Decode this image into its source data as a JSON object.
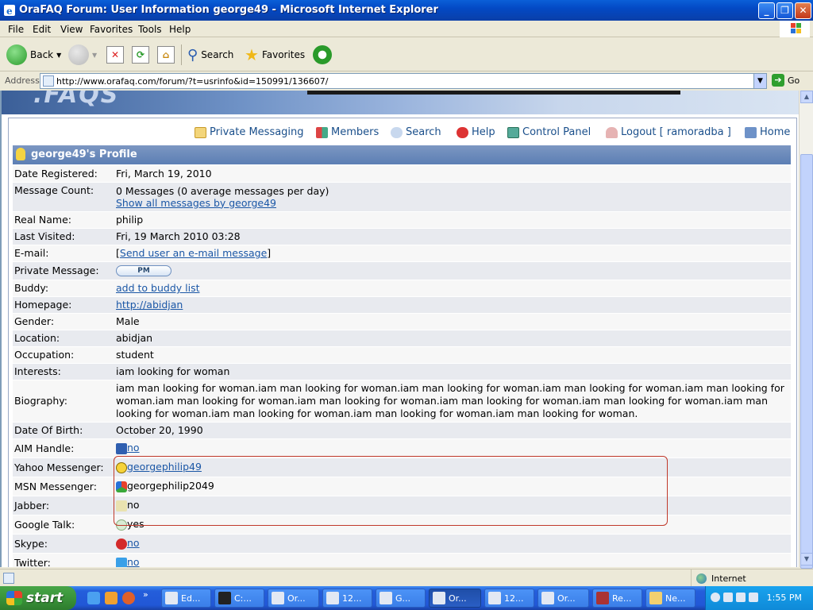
{
  "window": {
    "title": "OraFAQ Forum: User Information george49 - Microsoft Internet Explorer",
    "min": "_",
    "max": "❐",
    "close": "✕"
  },
  "menu": [
    "File",
    "Edit",
    "View",
    "Favorites",
    "Tools",
    "Help"
  ],
  "toolbar": {
    "back": "Back",
    "search": "Search",
    "favorites": "Favorites"
  },
  "address": {
    "label": "Address",
    "url": "http://www.orafaq.com/forum/?t=usrinfo&id=150991/136607/",
    "go": "Go"
  },
  "nav": {
    "private_messaging": "Private Messaging",
    "members": "Members",
    "search": "Search",
    "help": "Help",
    "control_panel": "Control Panel",
    "logout": "Logout [ ramoradba ]",
    "home": "Home"
  },
  "profile": {
    "heading": "george49's Profile",
    "date_registered_label": "Date Registered:",
    "date_registered": "Fri, March 19, 2010",
    "message_count_label": "Message Count:",
    "message_count": "0 Messages (0 average messages per day)",
    "show_all_link": "Show all messages by george49",
    "real_name_label": "Real Name:",
    "real_name": "philip",
    "last_visited_label": "Last Visited:",
    "last_visited": "Fri, 19 March 2010 03:28",
    "email_label": "E-mail:",
    "email_open": "[",
    "email_link": "Send user an e-mail message",
    "email_close": "]",
    "pm_label": "Private Message:",
    "pm_button": "PM",
    "buddy_label": "Buddy:",
    "buddy_link": "add to buddy list",
    "homepage_label": "Homepage:",
    "homepage_link": "http://abidjan",
    "gender_label": "Gender:",
    "gender": "Male",
    "location_label": "Location:",
    "location": "abidjan",
    "occupation_label": "Occupation:",
    "occupation": "student",
    "interests_label": "Interests:",
    "interests": "iam looking for woman",
    "biography_label": "Biography:",
    "biography": "iam man looking for woman.iam man looking for woman.iam man looking for woman.iam man looking for woman.iam man looking for woman.iam man looking for woman.iam man looking for woman.iam man looking for woman.iam man looking for woman.iam man looking for woman.iam man looking for woman.iam man looking for woman.iam man looking for woman.",
    "dob_label": "Date Of Birth:",
    "dob": "October 20, 1990",
    "aim_label": "AIM Handle:",
    "aim": "no",
    "yahoo_label": "Yahoo Messenger:",
    "yahoo": "georgephilip49",
    "msn_label": "MSN Messenger:",
    "msn": "georgephilip2049",
    "jabber_label": "Jabber:",
    "jabber": "no",
    "gtalk_label": "Google Talk:",
    "gtalk": "yes",
    "skype_label": "Skype:",
    "skype": "no",
    "twitter_label": "Twitter:",
    "twitter": "no"
  },
  "status": {
    "zone": "Internet"
  },
  "taskbar": {
    "start": "start",
    "tasks": [
      "Ed...",
      "C:...",
      "Or...",
      "12...",
      "G...",
      "Or...",
      "12...",
      "Or...",
      "Re...",
      "Ne..."
    ],
    "clock": "1:55 PM"
  },
  "colors": {
    "link": "#1b57a6",
    "header": "#5c7fb4",
    "annotation": "#c0392b"
  }
}
